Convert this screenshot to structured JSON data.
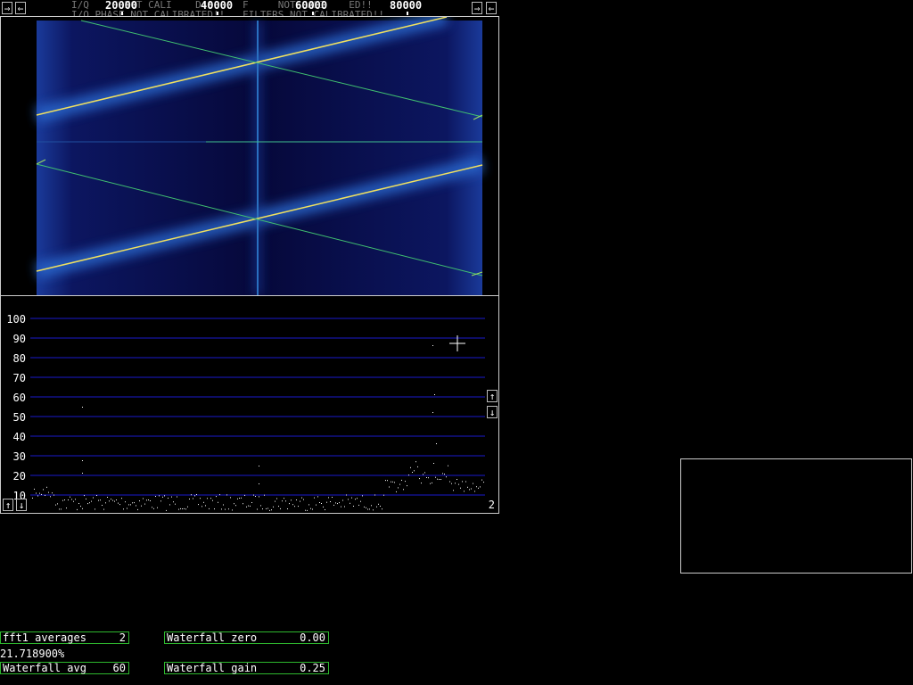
{
  "freq_bar": {
    "labels": [
      "20000",
      "40000",
      "60000",
      "80000"
    ],
    "left_arrows": [
      "⇒",
      "⇐"
    ],
    "right_arrows": [
      "⇒",
      "⇐"
    ]
  },
  "spectrum": {
    "y_ticks": [
      "100",
      "90",
      "80",
      "70",
      "60",
      "50",
      "40",
      "30",
      "20",
      "10"
    ],
    "corner_number": "2",
    "arrows": {
      "up": "↑",
      "down": "↓"
    }
  },
  "params": {
    "fft1_averages": {
      "label": "fft1 averages",
      "value": "2"
    },
    "waterfall_avg": {
      "label": "Waterfall avg",
      "value": "60"
    },
    "waterfall_zero": {
      "label": "Waterfall zero",
      "value": "0.00"
    },
    "waterfall_gain": {
      "label": "Waterfall gain",
      "value": "0.25"
    }
  },
  "status_percent": "21.718900%",
  "colors": {
    "waterfall_bg": "#0a0a3a",
    "grid": "#1a1acc",
    "param_border": "#2eb82e",
    "trace_yellow": "#f0e060",
    "trace_green": "#40c070"
  }
}
